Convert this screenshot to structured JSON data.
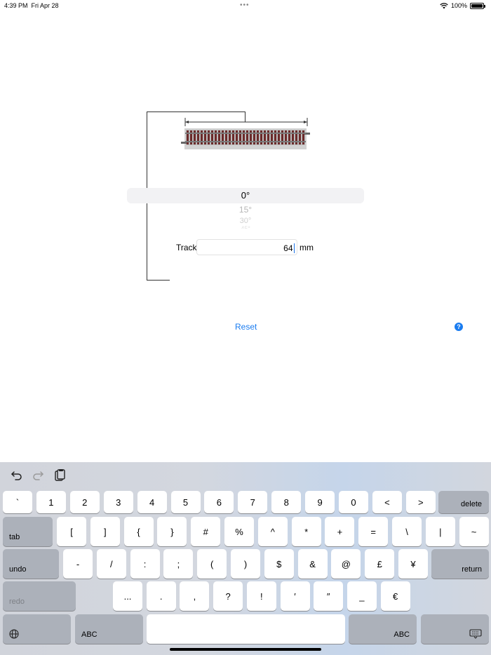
{
  "status_bar": {
    "time": "4:39 PM",
    "date": "Fri Apr 28",
    "battery": "100%",
    "battery_level": 1.0,
    "dots": "•••"
  },
  "angle_picker": {
    "selected": "0°",
    "options": [
      "0°",
      "15°",
      "30°",
      "45°"
    ]
  },
  "track": {
    "label": "Track",
    "value": "64",
    "unit": "mm"
  },
  "actions": {
    "reset_label": "Reset",
    "help_label": "?"
  },
  "colors": {
    "accent": "#1a7cf0",
    "rail": "#6b2a2a",
    "ballast": "#c8c8c8"
  },
  "keyboard": {
    "row1": [
      "`",
      "1",
      "2",
      "3",
      "4",
      "5",
      "6",
      "7",
      "8",
      "9",
      "0",
      "<",
      ">"
    ],
    "delete_label": "delete",
    "tab_label": "tab",
    "row2": [
      "[",
      "]",
      "{",
      "}",
      "#",
      "%",
      "^",
      "*",
      "+",
      "=",
      "\\",
      "|",
      "~"
    ],
    "undo_label": "undo",
    "row3": [
      "-",
      "/",
      ":",
      ";",
      "(",
      ")",
      "$",
      "&",
      "@",
      "£",
      "¥"
    ],
    "return_label": "return",
    "redo_label": "redo",
    "row4": [
      "...",
      ".",
      ",",
      "?",
      "!",
      "′",
      "″",
      "_",
      "€"
    ],
    "abc_label": "ABC"
  }
}
